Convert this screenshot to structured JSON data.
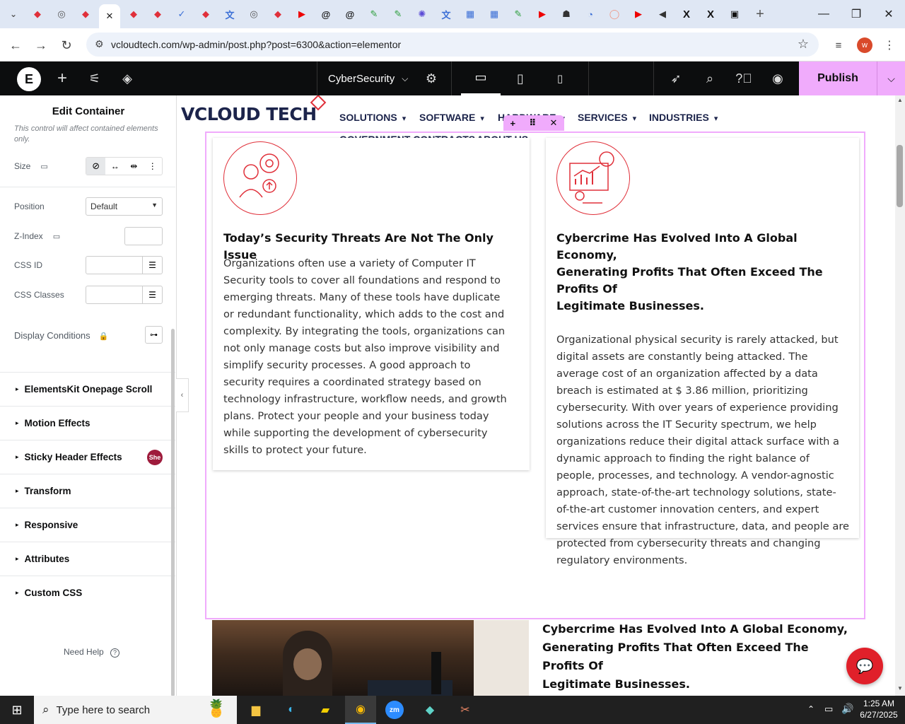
{
  "browser": {
    "tabs": [
      {
        "icon": "v-logo-icon",
        "color": "#e0303a"
      },
      {
        "icon": "globe-icon",
        "color": "#555"
      },
      {
        "icon": "v-logo-icon",
        "color": "#e0303a"
      },
      {
        "icon": "close-icon",
        "color": "#222",
        "active": true
      },
      {
        "icon": "v-logo-icon",
        "color": "#e0303a"
      },
      {
        "icon": "v-logo-icon",
        "color": "#e0303a"
      },
      {
        "icon": "check-icon",
        "color": "#3b6fd6"
      },
      {
        "icon": "v-logo-icon",
        "color": "#e0303a"
      },
      {
        "icon": "translate-icon",
        "color": "#3b6fd6"
      },
      {
        "icon": "globe-icon",
        "color": "#555"
      },
      {
        "icon": "v-logo-icon",
        "color": "#e0303a"
      },
      {
        "icon": "youtube-icon",
        "color": "#e00"
      },
      {
        "icon": "threads-icon",
        "color": "#111"
      },
      {
        "icon": "threads-icon",
        "color": "#111"
      },
      {
        "icon": "pen-icon",
        "color": "#2a9d3a"
      },
      {
        "icon": "pen-icon",
        "color": "#2a9d3a"
      },
      {
        "icon": "openai-icon",
        "color": "#5b4bd6"
      },
      {
        "icon": "translate-icon",
        "color": "#3b6fd6"
      },
      {
        "icon": "grid-icon",
        "color": "#3b6fd6"
      },
      {
        "icon": "grid-icon",
        "color": "#3b6fd6"
      },
      {
        "icon": "pen-icon",
        "color": "#2a9d3a"
      },
      {
        "icon": "youtube-icon",
        "color": "#e00"
      },
      {
        "icon": "lock-icon",
        "color": "#333"
      },
      {
        "icon": "cast-icon",
        "color": "#3b6fd6"
      },
      {
        "icon": "ring-icon",
        "color": "#e98"
      },
      {
        "icon": "youtube-icon",
        "color": "#e00"
      },
      {
        "icon": "speaker-icon",
        "color": "#333"
      },
      {
        "icon": "x-icon",
        "color": "#111"
      },
      {
        "icon": "x-icon",
        "color": "#111"
      },
      {
        "icon": "jetbrains-icon",
        "color": "#111"
      }
    ],
    "new_tab_label": "+",
    "url": "vcloudtech.com/wp-admin/post.php?post=6300&action=elementor",
    "profile_initial": "w"
  },
  "elementor": {
    "page_name": "CyberSecurity",
    "publish_label": "Publish",
    "panel_title": "Edit Container",
    "panel_note": "This control will affect contained elements only.",
    "fields": {
      "size": "Size",
      "position": "Position",
      "position_value": "Default",
      "zindex": "Z-Index",
      "css_id": "CSS ID",
      "css_classes": "CSS Classes",
      "display_conditions": "Display Conditions"
    },
    "sections": [
      "ElementsKit Onepage Scroll",
      "Motion Effects",
      "Sticky Header Effects",
      "Transform",
      "Responsive",
      "Attributes",
      "Custom CSS"
    ],
    "sticky_badge": "She",
    "need_help": "Need Help"
  },
  "site": {
    "logo": "VCLOUD TECH",
    "menu": [
      "SOLUTIONS",
      "SOFTWARE",
      "HARDWARE",
      "SERVICES",
      "INDUSTRIES",
      "GOVERNMENT CONTRACTS",
      "ABOUT US"
    ],
    "card1": {
      "title": "Today’s Security Threats Are Not The Only Issue",
      "lines": [
        "Organizations often use a variety of Computer IT",
        "Security tools to cover all foundations and respond to",
        "emerging threats. Many of these tools have duplicate",
        "or redundant functionality, which adds to the cost and",
        "complexity. By integrating the tools, organizations can",
        "not only manage costs but also improve visibility and",
        "simplify security processes. A good approach to",
        "security requires a coordinated strategy based on",
        "technology infrastructure, workflow needs, and growth",
        "plans. Protect your people and your business today",
        "while supporting the development of cybersecurity",
        "skills to protect your future."
      ]
    },
    "card2": {
      "title_lines": [
        "Cybercrime Has Evolved Into A Global Economy,",
        "Generating Profits That Often Exceed The Profits Of",
        "Legitimate Businesses."
      ],
      "lines": [
        "Organizational physical security is rarely attacked, but",
        "digital assets are constantly being attacked. The",
        "average cost of an organization affected by a data",
        "breach is estimated at $ 3.86 million, prioritizing",
        "cybersecurity. With over years of experience providing",
        "solutions across the IT Security spectrum, we help",
        "organizations reduce their digital attack surface with a",
        "dynamic approach to finding the right balance of",
        "people, processes, and technology. A vendor-agnostic",
        "approach, state-of-the-art technology solutions, state-",
        "of-the-art customer innovation centers, and expert",
        "services ensure that infrastructure, data, and people are",
        "protected from cybersecurity threats and changing",
        "regulatory environments."
      ]
    },
    "bottom_heading_lines": [
      "Cybercrime Has Evolved Into A Global Economy,",
      "Generating Profits That Often Exceed The Profits Of",
      "Legitimate Businesses."
    ]
  },
  "taskbar": {
    "search_placeholder": "Type here to search",
    "time": "1:25 AM",
    "date": "6/27/2025"
  },
  "colors": {
    "accent_red": "#e0303a",
    "elementor_pink": "#f0abfc",
    "menu_navy": "#1c244b"
  }
}
